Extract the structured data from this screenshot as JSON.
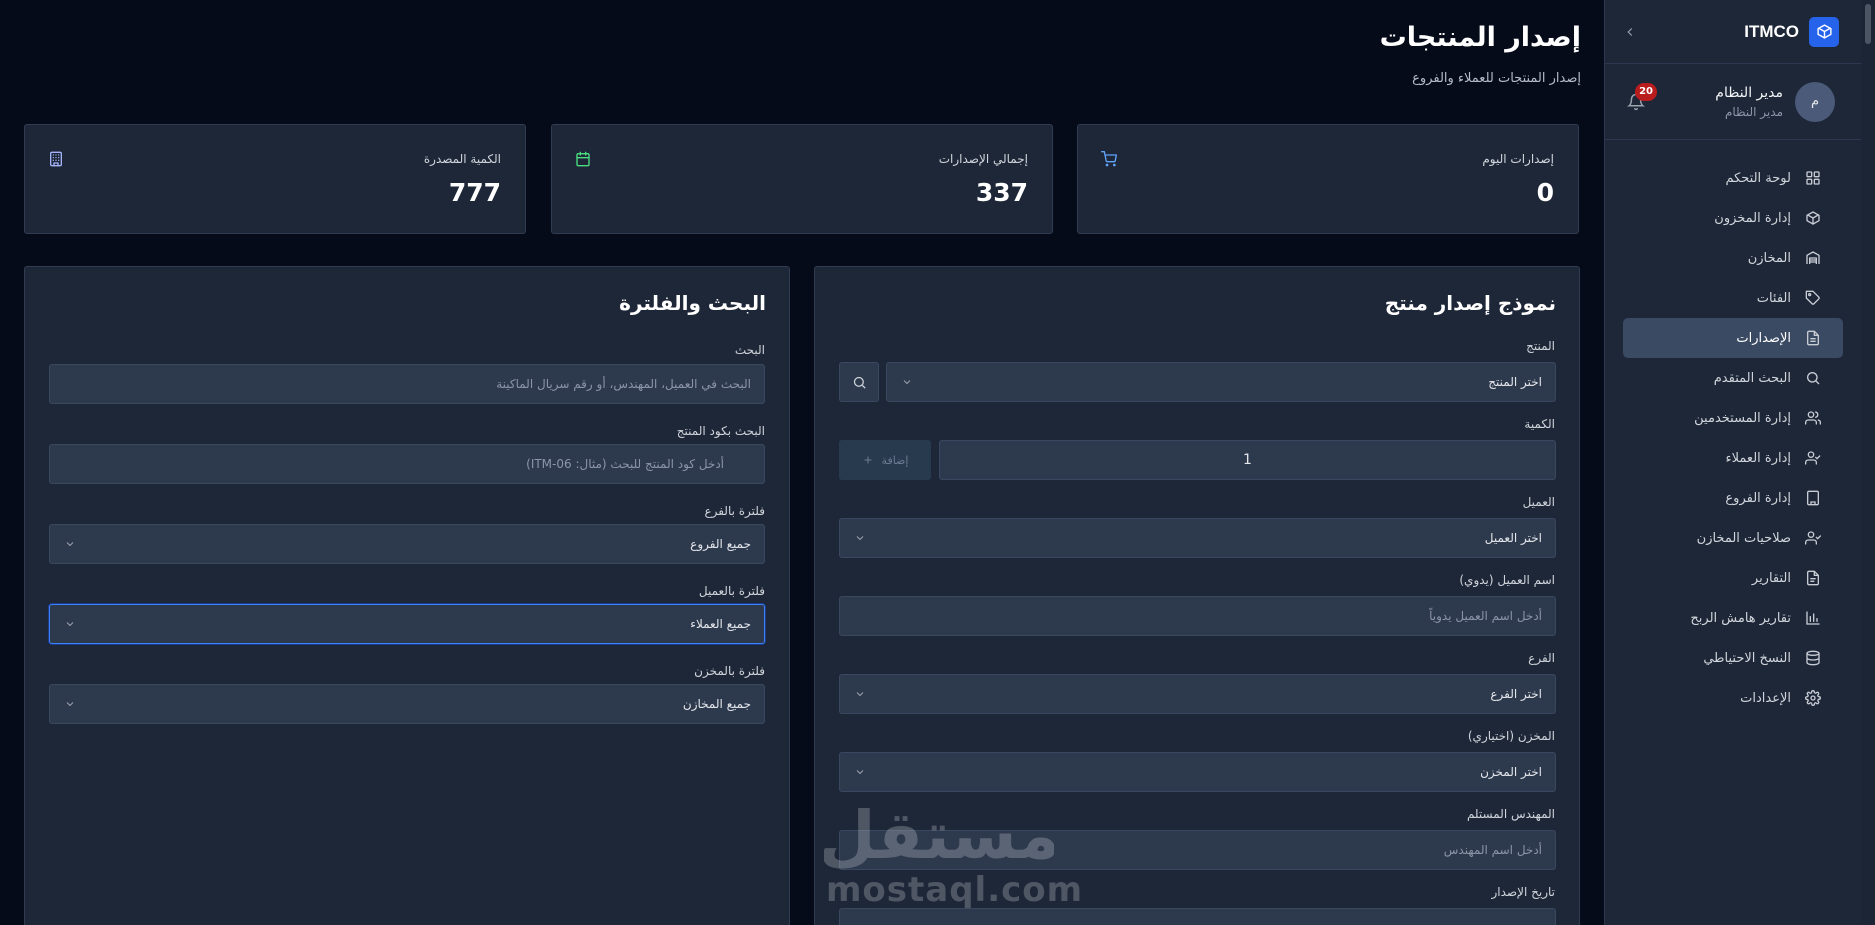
{
  "brand": {
    "name": "ITMCO"
  },
  "user": {
    "name": "مدير النظام",
    "role": "مدير النظام",
    "initial": "م",
    "notifications": "20"
  },
  "nav": [
    {
      "label": "لوحة التحكم",
      "icon": "grid-icon"
    },
    {
      "label": "إدارة المخزون",
      "icon": "box-icon"
    },
    {
      "label": "المخازن",
      "icon": "warehouse-icon"
    },
    {
      "label": "الفئات",
      "icon": "tag-icon"
    },
    {
      "label": "الإصدارات",
      "icon": "document-icon",
      "active": true
    },
    {
      "label": "البحث المتقدم",
      "icon": "search-icon"
    },
    {
      "label": "إدارة المستخدمين",
      "icon": "users-icon"
    },
    {
      "label": "إدارة العملاء",
      "icon": "user-check-icon"
    },
    {
      "label": "إدارة الفروع",
      "icon": "building-icon"
    },
    {
      "label": "صلاحيات المخازن",
      "icon": "user-permission-icon"
    },
    {
      "label": "التقارير",
      "icon": "report-icon"
    },
    {
      "label": "تقارير هامش الربح",
      "icon": "bar-chart-icon"
    },
    {
      "label": "النسخ الاحتياطي",
      "icon": "database-icon"
    },
    {
      "label": "الإعدادات",
      "icon": "gear-icon"
    }
  ],
  "page": {
    "title": "إصدار المنتجات",
    "subtitle": "إصدار المنتجات للعملاء والفروع"
  },
  "stats": [
    {
      "label": "إصدارات اليوم",
      "value": "0",
      "icon": "cart-icon",
      "color": "#60a5fa"
    },
    {
      "label": "إجمالي الإصدارات",
      "value": "337",
      "icon": "calendar-icon",
      "color": "#4ade80"
    },
    {
      "label": "الكمية المصدرة",
      "value": "777",
      "icon": "building-icon",
      "color": "#a5b4fc"
    }
  ],
  "issue_form": {
    "title": "نموذج إصدار منتج",
    "product_label": "المنتج",
    "product_value": "اختر المنتج",
    "quantity_label": "الكمية",
    "quantity_value": "1",
    "add_label": "إضافة",
    "client_label": "العميل",
    "client_value": "اختر العميل",
    "manual_client_label": "اسم العميل (يدوي)",
    "manual_client_placeholder": "أدخل اسم العميل يدوياً",
    "branch_label": "الفرع",
    "branch_value": "اختر الفرع",
    "warehouse_label": "المخزن (اختياري)",
    "warehouse_value": "اختر المخزن",
    "engineer_label": "المهندس المستلم",
    "engineer_placeholder": "أدخل اسم المهندس",
    "date_label": "تاريخ الإصدار"
  },
  "filter": {
    "title": "البحث والفلترة",
    "search_label": "البحث",
    "search_placeholder": "البحث في العميل، المهندس، أو رقم سريال الماكينة",
    "code_label": "البحث بكود المنتج",
    "code_placeholder": "أدخل كود المنتج للبحث (مثال: ITM-06)",
    "branch_label": "فلترة بالفرع",
    "branch_value": "جميع الفروع",
    "client_label": "فلترة بالعميل",
    "client_value": "جميع العملاء",
    "warehouse_label": "فلترة بالمخزن",
    "warehouse_value": "جميع المخازن"
  },
  "watermark": {
    "ar": "مستقل",
    "en": "mostaql.com"
  }
}
